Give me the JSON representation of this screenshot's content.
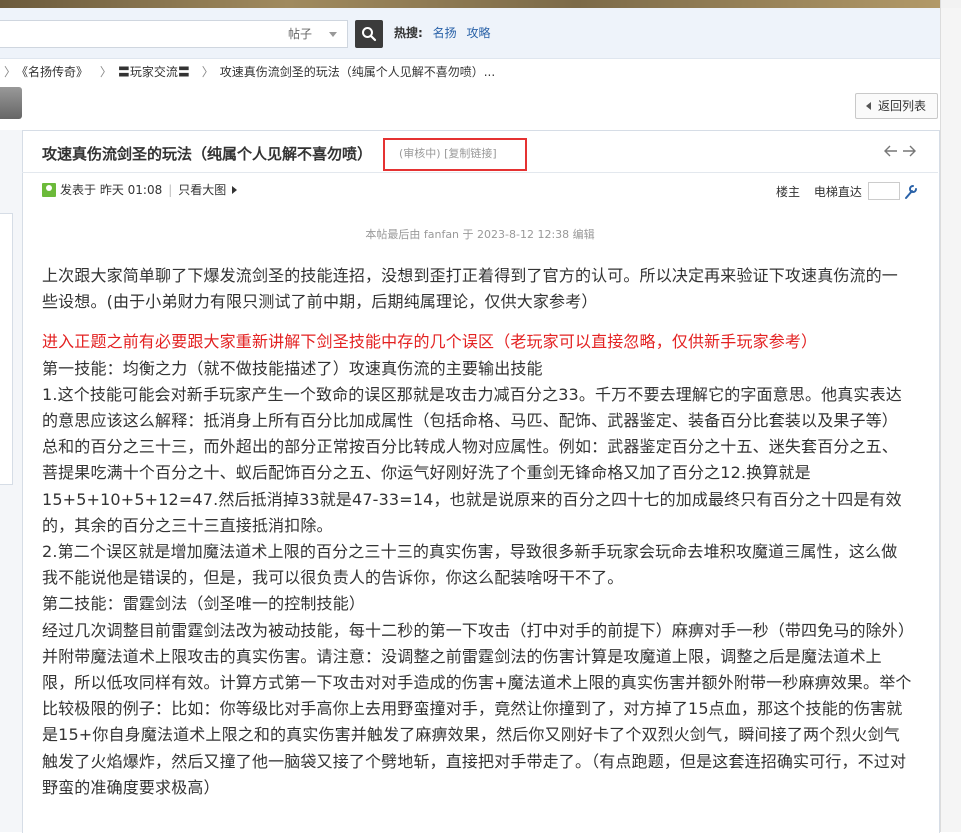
{
  "search": {
    "type_label": "帖子",
    "hot_label": "热搜:",
    "hot_links": [
      "名扬",
      "攻略"
    ]
  },
  "breadcrumb": {
    "items": [
      "《名扬传奇》",
      "〓玩家交流〓",
      "攻速真伤流剑圣的玩法（纯属个人见解不喜勿喷）..."
    ]
  },
  "back_label": "返回列表",
  "post": {
    "title": "攻速真伤流剑圣的玩法（纯属个人见解不喜勿喷）",
    "status": "(审核中)",
    "copy_link": "[复制链接]",
    "posted": "发表于 昨天 01:08",
    "only_images": "只看大图",
    "floor_owner": "楼主",
    "floor_jump": "电梯直达",
    "edited": "本帖最后由 fanfan 于 2023-8-12 12:38 编辑",
    "paragraphs": [
      "上次跟大家简单聊了下爆发流剑圣的技能连招，没想到歪打正着得到了官方的认可。所以决定再来验证下攻速真伤流的一些设想。(由于小弟财力有限只测试了前中期，后期纯属理论，仅供大家参考）",
      "进入正题之前有必要跟大家重新讲解下剑圣技能中存的几个误区（老玩家可以直接忽略，仅供新手玩家参考）",
      "第一技能：均衡之力（就不做技能描述了）攻速真伤流的主要输出技能",
      "1.这个技能可能会对新手玩家产生一个致命的误区那就是攻击力减百分之33。千万不要去理解它的字面意思。他真实表达的意思应该这么解释：抵消身上所有百分比加成属性（包括命格、马匹、配饰、武器鉴定、装备百分比套装以及果子等）总和的百分之三十三，而外超出的部分正常按百分比转成人物对应属性。例如：武器鉴定百分之十五、迷失套百分之五、菩提果吃满十个百分之十、蚁后配饰百分之五、你运气好刚好洗了个重剑无锋命格又加了百分之12.换算就是15+5+10+5+12=47.然后抵消掉33就是47-33=14，也就是说原来的百分之四十七的加成最终只有百分之十四是有效的，其余的百分之三十三直接抵消扣除。",
      "2.第二个误区就是增加魔法道术上限的百分之三十三的真实伤害，导致很多新手玩家会玩命去堆积攻魔道三属性，这么做我不能说他是错误的，但是，我可以很负责人的告诉你，你这么配装啥呀干不了。",
      "第二技能：雷霆剑法（剑圣唯一的控制技能）",
      "经过几次调整目前雷霆剑法改为被动技能，每十二秒的第一下攻击（打中对手的前提下）麻痹对手一秒（带四免马的除外）并附带魔法道术上限攻击的真实伤害。请注意：没调整之前雷霆剑法的伤害计算是攻魔道上限，调整之后是魔法道术上限，所以低攻同样有效。计算方式第一下攻击对对手造成的伤害+魔法道术上限的真实伤害并额外附带一秒麻痹效果。举个比较极限的例子：比如：你等级比对手高你上去用野蛮撞对手，竟然让你撞到了，对方掉了15点血，那这个技能的伤害就是15+你自身魔法道术上限之和的真实伤害并触发了麻痹效果，然后你又刚好卡了个双烈火剑气，瞬间接了两个烈火剑气触发了火焰爆炸，然后又撞了他一脑袋又接了个劈地斩，直接把对手带走了。（有点跑题，但是这套连招确实可行，不过对野蛮的准确度要求极高）"
    ]
  }
}
